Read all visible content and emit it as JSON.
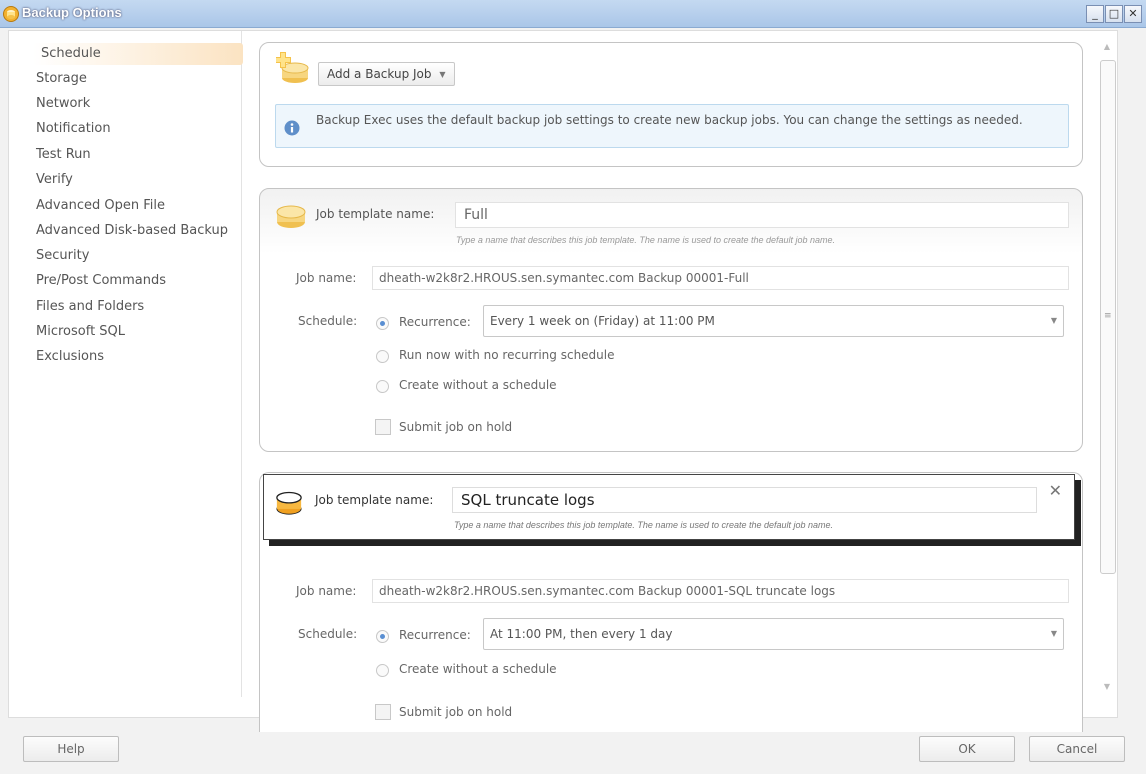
{
  "window": {
    "title": "Backup Options",
    "minimize": "_",
    "maximize": "□",
    "close": "✕"
  },
  "sidebar": {
    "items": [
      {
        "label": "Schedule",
        "active": true
      },
      {
        "label": "Storage"
      },
      {
        "label": "Network"
      },
      {
        "label": "Notification"
      },
      {
        "label": "Test Run"
      },
      {
        "label": "Verify"
      },
      {
        "label": "Advanced Open File"
      },
      {
        "label": "Advanced Disk-based Backup"
      },
      {
        "label": "Security"
      },
      {
        "label": "Pre/Post Commands"
      },
      {
        "label": "Files and Folders"
      },
      {
        "label": "Microsoft SQL"
      },
      {
        "label": "Exclusions"
      }
    ]
  },
  "top_panel": {
    "add_button": "Add a Backup Job",
    "dropdown_glyph": "▼",
    "info": "Backup Exec uses the default backup job settings to create new backup jobs. You can change the settings as needed."
  },
  "jobs": [
    {
      "template_label": "Job template name:",
      "template_name": "Full",
      "hint": "Type a name that describes this job template. The name is used to create the default job name.",
      "job_name_label": "Job name:",
      "job_name": "dheath-w2k8r2.HROUS.sen.symantec.com Backup 00001-Full",
      "schedule_label": "Schedule:",
      "recurrence_label": "Recurrence:",
      "recurrence_value": "Every 1 week on (Friday) at 11:00 PM",
      "option_run_now": "Run now with no recurring schedule",
      "option_no_schedule": "Create without a schedule",
      "submit_hold": "Submit job on hold"
    },
    {
      "template_label": "Job template name:",
      "template_name": "SQL truncate logs",
      "hint": "Type a name that describes this job template. The name is used to create the default job name.",
      "job_name_label": "Job name:",
      "job_name": "dheath-w2k8r2.HROUS.sen.symantec.com Backup 00001-SQL truncate logs",
      "schedule_label": "Schedule:",
      "recurrence_label": "Recurrence:",
      "recurrence_value": "At 11:00 PM, then every 1 day",
      "option_no_schedule": "Create without a schedule",
      "submit_hold": "Submit job on hold",
      "close": "✕"
    }
  ],
  "footer": {
    "help": "Help",
    "ok": "OK",
    "cancel": "Cancel"
  },
  "scrollbar": {
    "up": "▲",
    "down": "▼",
    "grip": "≡"
  },
  "colors": {
    "titlebar": "#aac6e8",
    "active_nav": "#fbe3c2",
    "info_bg": "#eef6fc",
    "radio_on": "#5a8fd2"
  }
}
